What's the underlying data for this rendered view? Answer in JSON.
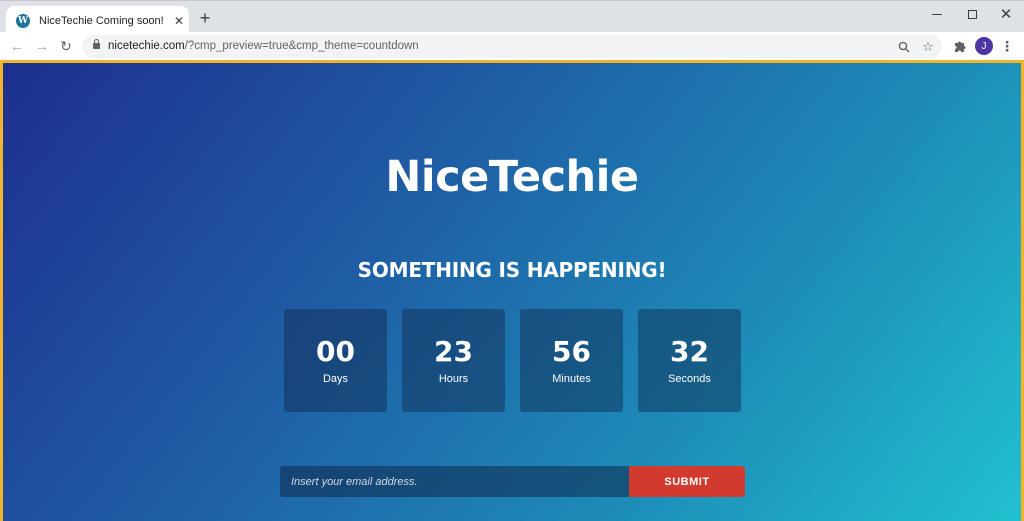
{
  "browser": {
    "tab": {
      "title": "NiceTechie Coming soon!"
    },
    "window_controls": {
      "minimize": "—",
      "maximize": "□",
      "close": "✕"
    },
    "url": {
      "host": "nicetechie.com",
      "path": "/?cmp_preview=true&cmp_theme=countdown"
    },
    "profile_initial": "J",
    "icons": {
      "favicon": "wordpress-icon",
      "close": "close-icon",
      "new_tab": "plus-icon",
      "back": "arrow-left-icon",
      "forward": "arrow-right-icon",
      "reload": "reload-icon",
      "lock": "lock-icon",
      "zoom": "magnifier-icon",
      "bookmark": "star-icon",
      "extensions": "puzzle-icon",
      "menu": "kebab-menu-icon"
    }
  },
  "page": {
    "site_title": "NiceTechie",
    "headline": "SOMETHING IS HAPPENING!",
    "countdown": [
      {
        "value": "00",
        "label": "Days"
      },
      {
        "value": "23",
        "label": "Hours"
      },
      {
        "value": "56",
        "label": "Minutes"
      },
      {
        "value": "32",
        "label": "Seconds"
      }
    ],
    "subscribe": {
      "placeholder": "Insert your email address.",
      "submit_label": "SUBMIT"
    }
  },
  "colors": {
    "accent_border": "#f2b52a",
    "submit_button": "#d23a2e",
    "gradient_start": "#1e2f8e",
    "gradient_end": "#21c1cf"
  }
}
